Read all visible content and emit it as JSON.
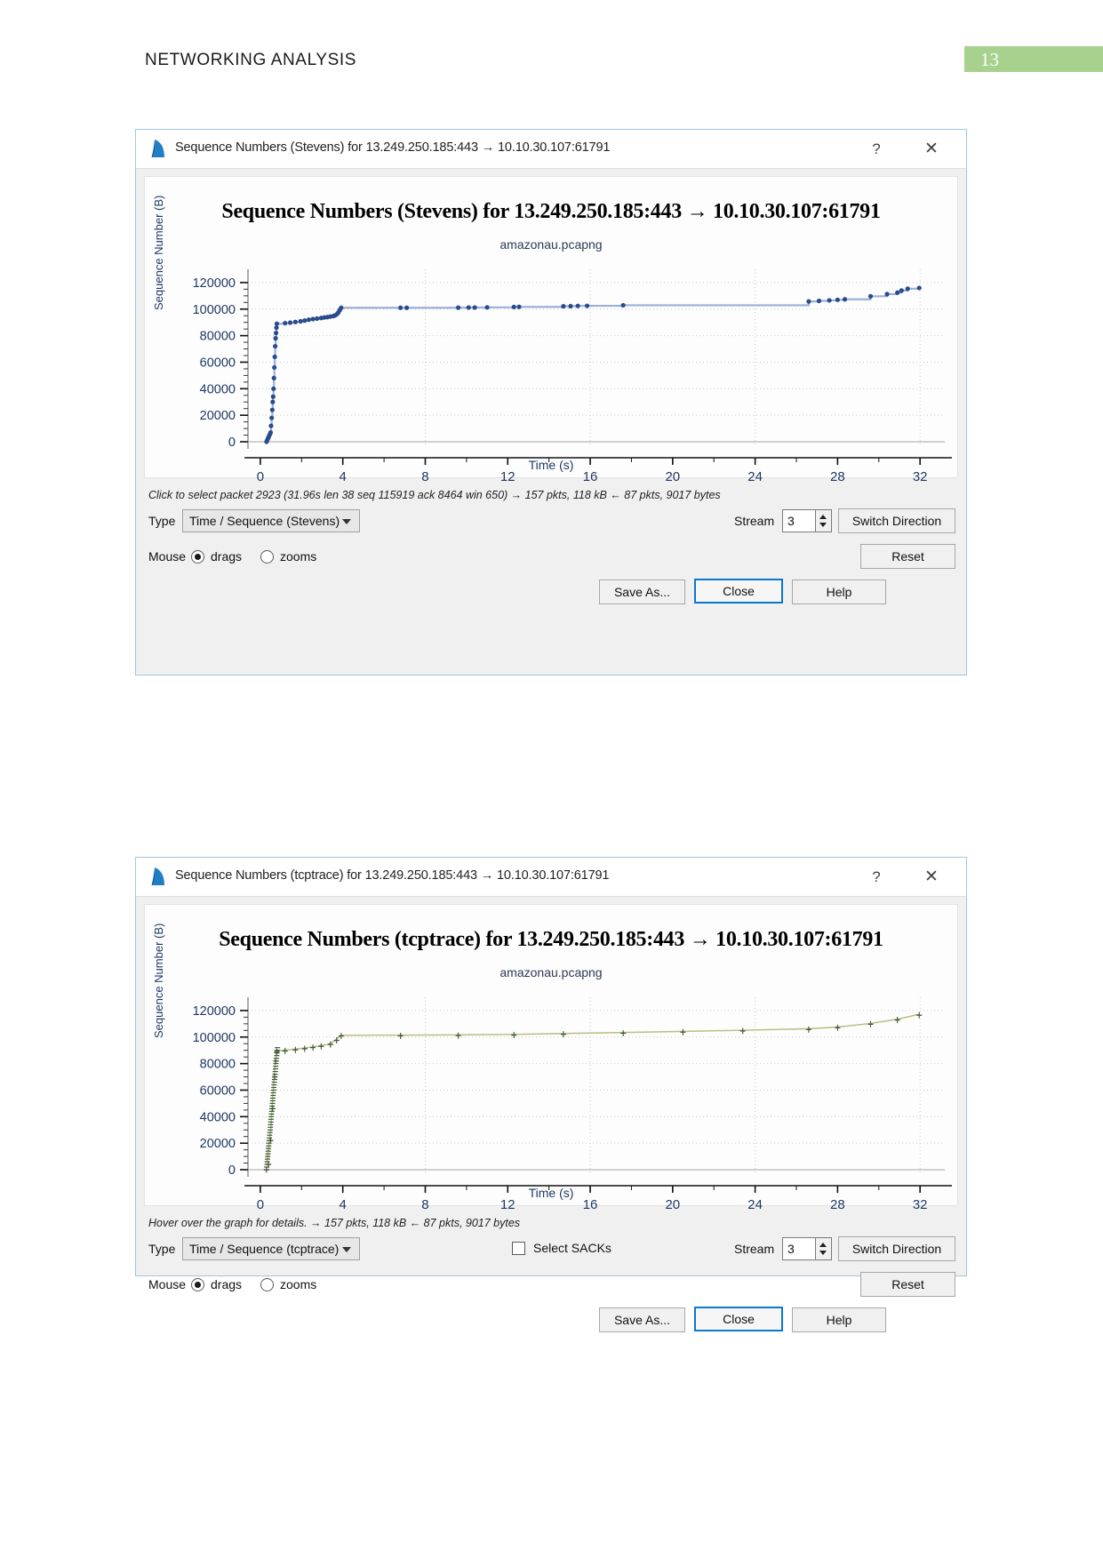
{
  "document": {
    "header_title": "NETWORKING ANALYSIS",
    "page_number": "13",
    "accent_color": "#a9d18e"
  },
  "dialogs": [
    {
      "window_title": "Sequence Numbers (Stevens) for 13.249.250.185:443 → 10.10.30.107:61791",
      "icon": "wireshark-fin-icon",
      "help_button": "?",
      "close_button": "✕",
      "chart_title": "Sequence Numbers (Stevens) for 13.249.250.185:443 → 10.10.30.107:61791",
      "chart_subtitle": "amazonau.pcapng",
      "status_text": "Click to select packet 2923 (31.96s len 38 seq 115919 ack 8464 win 650) → 157 pkts, 118 kB ← 87 pkts, 9017 bytes",
      "type_label": "Type",
      "type_value": "Time / Sequence (Stevens)",
      "mouse_label": "Mouse",
      "mouse_drags": "drags",
      "mouse_zooms": "zooms",
      "mouse_selected": "drags",
      "stream_label": "Stream",
      "stream_value": "3",
      "switch_direction": "Switch Direction",
      "reset": "Reset",
      "save_as": "Save As...",
      "close": "Close",
      "help": "Help",
      "has_sacks": false
    },
    {
      "window_title": "Sequence Numbers (tcptrace) for 13.249.250.185:443 → 10.10.30.107:61791",
      "icon": "wireshark-fin-icon",
      "help_button": "?",
      "close_button": "✕",
      "chart_title": "Sequence Numbers (tcptrace) for 13.249.250.185:443 → 10.10.30.107:61791",
      "chart_subtitle": "amazonau.pcapng",
      "status_text": "Hover over the graph for details. → 157 pkts, 118 kB ← 87 pkts, 9017 bytes",
      "type_label": "Type",
      "type_value": "Time / Sequence (tcptrace)",
      "select_sacks_label": "Select SACKs",
      "select_sacks_checked": false,
      "mouse_label": "Mouse",
      "mouse_drags": "drags",
      "mouse_zooms": "zooms",
      "mouse_selected": "drags",
      "stream_label": "Stream",
      "stream_value": "3",
      "switch_direction": "Switch Direction",
      "reset": "Reset",
      "save_as": "Save As...",
      "close": "Close",
      "help": "Help",
      "has_sacks": true
    }
  ],
  "chart_data": [
    {
      "type": "line",
      "title": "Sequence Numbers (Stevens) for 13.249.250.185:443 → 10.10.30.107:61791",
      "subtitle": "amazonau.pcapng",
      "xlabel": "Time (s)",
      "ylabel": "Sequence Number (B)",
      "xlim": [
        -0.6,
        33.2
      ],
      "ylim": [
        -4000,
        130000
      ],
      "xticks": [
        0,
        4,
        8,
        12,
        16,
        20,
        24,
        28,
        32
      ],
      "yticks": [
        0,
        20000,
        40000,
        60000,
        80000,
        100000,
        120000
      ],
      "grid": true,
      "legend": "none",
      "series_color": "#2a4b8d",
      "line_color": "#9bb0d8",
      "series": [
        {
          "name": "Sequence Number",
          "x": [
            0.3,
            0.34,
            0.38,
            0.42,
            0.46,
            0.5,
            0.52,
            0.55,
            0.58,
            0.6,
            0.62,
            0.64,
            0.66,
            0.68,
            0.7,
            0.72,
            0.74,
            0.76,
            0.78,
            0.8,
            1.2,
            1.45,
            1.7,
            1.95,
            2.15,
            2.35,
            2.55,
            2.75,
            2.95,
            3.1,
            3.25,
            3.4,
            3.55,
            3.62,
            3.7,
            3.78,
            3.85,
            3.92,
            6.8,
            7.1,
            9.6,
            10.1,
            10.4,
            11.0,
            12.3,
            12.55,
            14.7,
            15.05,
            15.4,
            15.85,
            17.6,
            26.6,
            27.1,
            27.6,
            28.0,
            28.35,
            29.6,
            30.4,
            30.9,
            31.1,
            31.4,
            31.96
          ],
          "y": [
            0,
            1400,
            2800,
            4200,
            5600,
            7000,
            12000,
            18000,
            24000,
            30000,
            34000,
            40000,
            48000,
            56000,
            64000,
            72000,
            78000,
            82000,
            86000,
            89000,
            89400,
            89800,
            90300,
            90800,
            91400,
            92000,
            92500,
            92900,
            93300,
            93700,
            94000,
            94400,
            94800,
            95300,
            96000,
            97400,
            99200,
            101000,
            101000,
            101000,
            101100,
            101200,
            101200,
            101300,
            101600,
            101700,
            102100,
            102200,
            102400,
            102500,
            102900,
            105800,
            106200,
            106600,
            107000,
            107400,
            109700,
            111300,
            112400,
            114000,
            115400,
            115957
          ]
        }
      ]
    },
    {
      "type": "line",
      "title": "Sequence Numbers (tcptrace) for 13.249.250.185:443 → 10.10.30.107:61791",
      "subtitle": "amazonau.pcapng",
      "xlabel": "Time (s)",
      "ylabel": "Sequence Number (B)",
      "xlim": [
        -0.6,
        33.2
      ],
      "ylim": [
        -4000,
        130000
      ],
      "xticks": [
        0,
        4,
        8,
        12,
        16,
        20,
        24,
        28,
        32
      ],
      "yticks": [
        0,
        20000,
        40000,
        60000,
        80000,
        100000,
        120000
      ],
      "grid": true,
      "legend": "none",
      "window_color": "#d6d9a8",
      "segment_color": "#3d5636",
      "series": [
        {
          "name": "Receive Window (upper edge)",
          "x": [
            0.3,
            0.5,
            0.7,
            0.8,
            1.2,
            1.7,
            2.15,
            2.55,
            2.95,
            3.4,
            3.7,
            3.92,
            6.8,
            9.6,
            12.3,
            14.7,
            17.6,
            20.5,
            23.4,
            26.6,
            28.0,
            29.6,
            30.9,
            31.96
          ],
          "y": [
            5000,
            30000,
            78000,
            89800,
            90200,
            91000,
            91800,
            92700,
            93600,
            95000,
            98500,
            101400,
            101500,
            101700,
            102100,
            102700,
            103500,
            104300,
            105200,
            106300,
            107600,
            110300,
            113500,
            117200
          ]
        },
        {
          "name": "Data Segments (SEQ)",
          "x": [
            0.3,
            0.4,
            0.5,
            0.6,
            0.7,
            0.75,
            0.8,
            1.2,
            1.7,
            2.15,
            2.55,
            2.95,
            3.4,
            3.7,
            3.92,
            6.8,
            9.6,
            12.3,
            14.7,
            17.6,
            20.5,
            23.4,
            26.6,
            28.0,
            29.6,
            30.9,
            31.96
          ],
          "y": [
            0,
            4000,
            22000,
            46000,
            70000,
            82000,
            89000,
            89500,
            90300,
            91200,
            92100,
            93000,
            94400,
            97500,
            100800,
            100900,
            101100,
            101500,
            102100,
            102900,
            103700,
            104600,
            105700,
            107000,
            109700,
            112900,
            116500
          ]
        }
      ]
    }
  ]
}
